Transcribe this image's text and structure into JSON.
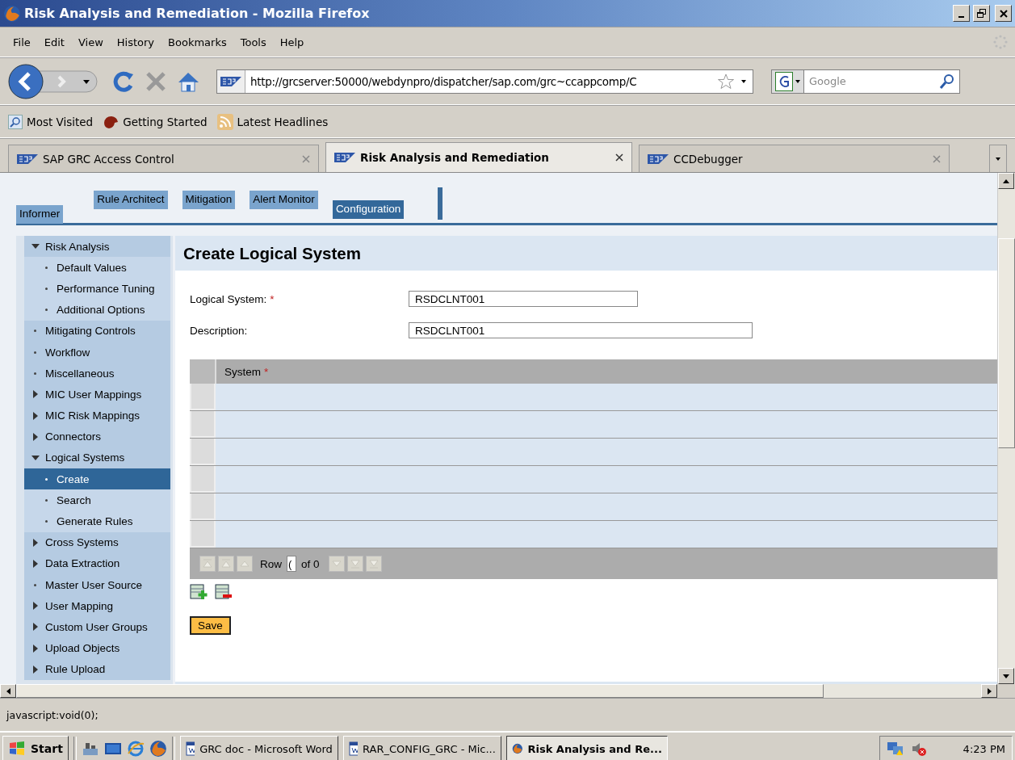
{
  "window": {
    "title": "Risk Analysis and Remediation - Mozilla Firefox"
  },
  "menu": [
    "File",
    "Edit",
    "View",
    "History",
    "Bookmarks",
    "Tools",
    "Help"
  ],
  "address_bar": {
    "value": "http://grcserver:50000/webdynpro/dispatcher/sap.com/grc~ccappcomp/C"
  },
  "search": {
    "placeholder": "Google"
  },
  "bookmarks": [
    "Most Visited",
    "Getting Started",
    "Latest Headlines"
  ],
  "browser_tabs": [
    {
      "label": "SAP GRC Access Control",
      "selected": false
    },
    {
      "label": "Risk Analysis and Remediation",
      "selected": true
    },
    {
      "label": "CCDebugger",
      "selected": false
    }
  ],
  "portal_tabs": [
    {
      "label": "Informer",
      "selected": false
    },
    {
      "label": "Rule Architect",
      "selected": false
    },
    {
      "label": "Mitigation",
      "selected": false
    },
    {
      "label": "Alert Monitor",
      "selected": false
    },
    {
      "label": "Configuration",
      "selected": true
    }
  ],
  "sidebar": {
    "items": [
      {
        "label": "Risk Analysis",
        "kind": "folder",
        "expanded": true,
        "selected": false,
        "children": [
          {
            "label": "Default Values",
            "kind": "leaf",
            "selected": false
          },
          {
            "label": "Performance Tuning",
            "kind": "leaf",
            "selected": false
          },
          {
            "label": "Additional Options",
            "kind": "leaf",
            "selected": false
          }
        ]
      },
      {
        "label": "Mitigating Controls",
        "kind": "leaf",
        "selected": false
      },
      {
        "label": "Workflow",
        "kind": "leaf",
        "selected": false
      },
      {
        "label": "Miscellaneous",
        "kind": "leaf",
        "selected": false
      },
      {
        "label": "MIC User Mappings",
        "kind": "folder",
        "expanded": false,
        "selected": false
      },
      {
        "label": "MIC Risk Mappings",
        "kind": "folder",
        "expanded": false,
        "selected": false
      },
      {
        "label": "Connectors",
        "kind": "folder",
        "expanded": false,
        "selected": false
      },
      {
        "label": "Logical Systems",
        "kind": "folder",
        "expanded": true,
        "selected": false,
        "children": [
          {
            "label": "Create",
            "kind": "leaf",
            "selected": true
          },
          {
            "label": "Search",
            "kind": "leaf",
            "selected": false
          },
          {
            "label": "Generate Rules",
            "kind": "leaf",
            "selected": false
          }
        ]
      },
      {
        "label": "Cross Systems",
        "kind": "folder",
        "expanded": false,
        "selected": false
      },
      {
        "label": "Data Extraction",
        "kind": "folder",
        "expanded": false,
        "selected": false
      },
      {
        "label": "Master User Source",
        "kind": "leaf",
        "selected": false
      },
      {
        "label": "User Mapping",
        "kind": "folder",
        "expanded": false,
        "selected": false
      },
      {
        "label": "Custom User Groups",
        "kind": "folder",
        "expanded": false,
        "selected": false
      },
      {
        "label": "Upload Objects",
        "kind": "folder",
        "expanded": false,
        "selected": false
      },
      {
        "label": "Rule Upload",
        "kind": "folder",
        "expanded": false,
        "selected": false
      }
    ]
  },
  "form": {
    "title": "Create Logical System",
    "fields": [
      {
        "label": "Logical System:",
        "mark": "*",
        "value": "RSDCLNT001"
      },
      {
        "label": "Description:",
        "value": "RSDCLNT001"
      }
    ]
  },
  "table": {
    "columns": [
      {
        "label": "System",
        "mark": "*"
      }
    ],
    "pager": {
      "row_label": "Row",
      "row_value": "(",
      "of_label": "of 0"
    }
  },
  "save_button": "Save",
  "status_bar": "javascript:void(0);",
  "taskbar": {
    "start": "Start",
    "tasks": [
      {
        "label": "GRC doc - Microsoft Word",
        "kind": "word",
        "selected": false
      },
      {
        "label": "RAR_CONFIG_GRC - Mic...",
        "kind": "word",
        "selected": false
      },
      {
        "label": "Risk Analysis and Re...",
        "kind": "firefox",
        "selected": true
      }
    ],
    "clock": "4:23 PM"
  }
}
